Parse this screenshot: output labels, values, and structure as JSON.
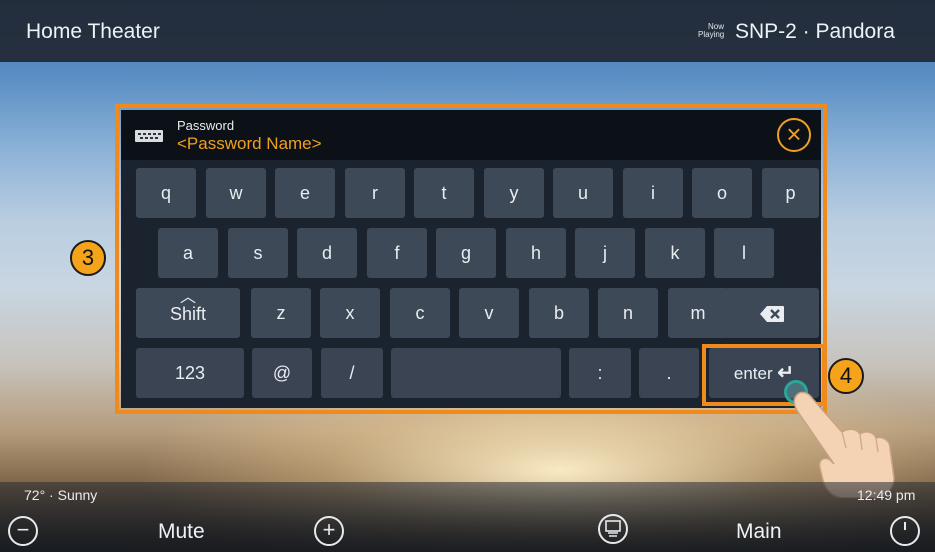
{
  "header": {
    "title": "Home Theater",
    "now_playing_line1": "Now",
    "now_playing_line2": "Playing",
    "source": "SNP-2 · Pandora"
  },
  "keyboard": {
    "field_label": "Password",
    "field_value": "<Password Name>",
    "close_icon": "close-circle",
    "row1": [
      "q",
      "w",
      "e",
      "r",
      "t",
      "y",
      "u",
      "i",
      "o",
      "p"
    ],
    "row2": [
      "a",
      "s",
      "d",
      "f",
      "g",
      "h",
      "j",
      "k",
      "l"
    ],
    "row3": [
      "z",
      "x",
      "c",
      "v",
      "b",
      "n",
      "m"
    ],
    "shift_label": "Shift",
    "numbers_label": "123",
    "at_label": "@",
    "slash_label": "/",
    "colon_label": ":",
    "period_label": ".",
    "enter_label": "enter"
  },
  "callouts": {
    "badge_3": "3",
    "badge_4": "4"
  },
  "footer": {
    "weather": "72° · Sunny",
    "time": "12:49 pm",
    "mute_label": "Mute",
    "main_label": "Main"
  },
  "colors": {
    "accent": "#f08a1c",
    "highlight_text": "#f0a020",
    "touch_ring": "#2ba69a"
  }
}
